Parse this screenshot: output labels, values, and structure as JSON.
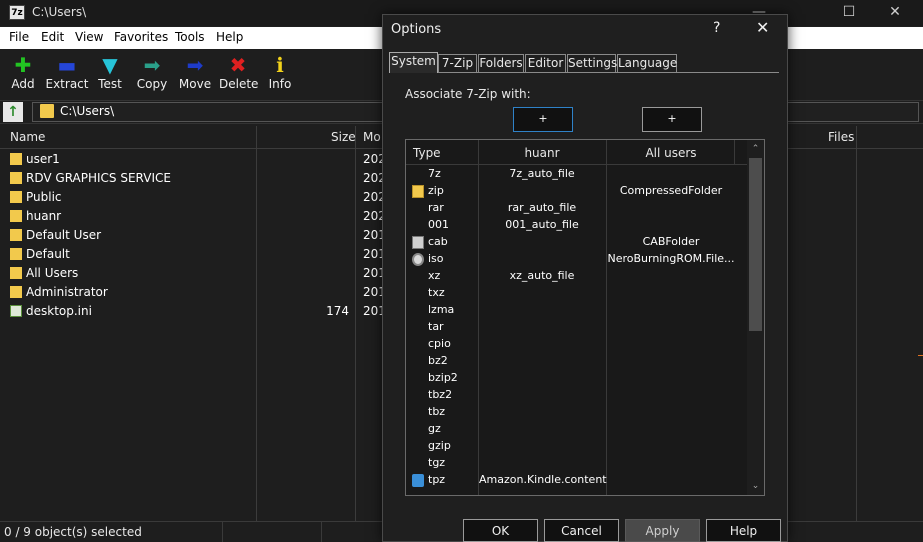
{
  "window": {
    "title": "C:\\Users\\",
    "app_icon": "7z",
    "controls": {
      "minimize": "—",
      "maximize": "☐",
      "close": "✕"
    }
  },
  "menu": [
    "File",
    "Edit",
    "View",
    "Favorites",
    "Tools",
    "Help"
  ],
  "toolbar": [
    {
      "label": "Add",
      "icon": "add-icon",
      "glyph": "✚",
      "color": "#22c322"
    },
    {
      "label": "Extract",
      "icon": "extract-icon",
      "glyph": "▬",
      "color": "#2546d8"
    },
    {
      "label": "Test",
      "icon": "test-icon",
      "glyph": "▼",
      "color": "#27c4d8"
    },
    {
      "label": "Copy",
      "icon": "copy-icon",
      "glyph": "➡",
      "color": "#2aa08a"
    },
    {
      "label": "Move",
      "icon": "move-icon",
      "glyph": "➡",
      "color": "#1e3bc9"
    },
    {
      "label": "Delete",
      "icon": "delete-icon",
      "glyph": "✖",
      "color": "#e02020"
    },
    {
      "label": "Info",
      "icon": "info-icon",
      "glyph": "ℹ",
      "color": "#f2d21b"
    }
  ],
  "address": {
    "path": "C:\\Users\\"
  },
  "filelist": {
    "columns": {
      "name": "Name",
      "size": "Size",
      "modified": "Mo",
      "files": "Files"
    },
    "rows": [
      {
        "name": "user1",
        "size": "",
        "modified": "2020",
        "kind": "folder"
      },
      {
        "name": "RDV GRAPHICS SERVICE",
        "size": "",
        "modified": "2020",
        "kind": "folder"
      },
      {
        "name": "Public",
        "size": "",
        "modified": "2020",
        "kind": "folder"
      },
      {
        "name": "huanr",
        "size": "",
        "modified": "2020",
        "kind": "folder"
      },
      {
        "name": "Default User",
        "size": "",
        "modified": "2019",
        "kind": "folder"
      },
      {
        "name": "Default",
        "size": "",
        "modified": "2019",
        "kind": "folder"
      },
      {
        "name": "All Users",
        "size": "",
        "modified": "2019",
        "kind": "folder"
      },
      {
        "name": "Administrator",
        "size": "",
        "modified": "2019",
        "kind": "folder"
      },
      {
        "name": "desktop.ini",
        "size": "174",
        "modified": "2019",
        "kind": "file"
      }
    ]
  },
  "status": {
    "text": "0 / 9 object(s) selected"
  },
  "dialog": {
    "title": "Options",
    "help_glyph": "?",
    "close_glyph": "✕",
    "tabs": [
      "System",
      "7-Zip",
      "Folders",
      "Editor",
      "Settings",
      "Language"
    ],
    "active_tab": "System",
    "associate_label": "Associate 7-Zip with:",
    "plus_user": "+",
    "plus_all": "+",
    "list_headers": {
      "type": "Type",
      "user": "huanr",
      "all": "All users"
    },
    "rows": [
      {
        "type": "7z",
        "user": "7z_auto_file",
        "all": "",
        "icon": ""
      },
      {
        "type": "zip",
        "user": "",
        "all": "CompressedFolder",
        "icon": "zip-folder-icon"
      },
      {
        "type": "rar",
        "user": "rar_auto_file",
        "all": "",
        "icon": ""
      },
      {
        "type": "001",
        "user": "001_auto_file",
        "all": "",
        "icon": ""
      },
      {
        "type": "cab",
        "user": "",
        "all": "CABFolder",
        "icon": "cab-icon"
      },
      {
        "type": "iso",
        "user": "",
        "all": "NeroBurningROM.File...",
        "icon": "disc-icon"
      },
      {
        "type": "xz",
        "user": "xz_auto_file",
        "all": "",
        "icon": ""
      },
      {
        "type": "txz",
        "user": "",
        "all": "",
        "icon": ""
      },
      {
        "type": "lzma",
        "user": "",
        "all": "",
        "icon": ""
      },
      {
        "type": "tar",
        "user": "",
        "all": "",
        "icon": ""
      },
      {
        "type": "cpio",
        "user": "",
        "all": "",
        "icon": ""
      },
      {
        "type": "bz2",
        "user": "",
        "all": "",
        "icon": ""
      },
      {
        "type": "bzip2",
        "user": "",
        "all": "",
        "icon": ""
      },
      {
        "type": "tbz2",
        "user": "",
        "all": "",
        "icon": ""
      },
      {
        "type": "tbz",
        "user": "",
        "all": "",
        "icon": ""
      },
      {
        "type": "gz",
        "user": "",
        "all": "",
        "icon": ""
      },
      {
        "type": "gzip",
        "user": "",
        "all": "",
        "icon": ""
      },
      {
        "type": "tgz",
        "user": "",
        "all": "",
        "icon": ""
      },
      {
        "type": "tpz",
        "user": "Amazon.Kindle.content",
        "all": "",
        "icon": "kindle-book-icon"
      }
    ],
    "buttons": {
      "ok": "OK",
      "cancel": "Cancel",
      "apply": "Apply",
      "help": "Help"
    }
  }
}
